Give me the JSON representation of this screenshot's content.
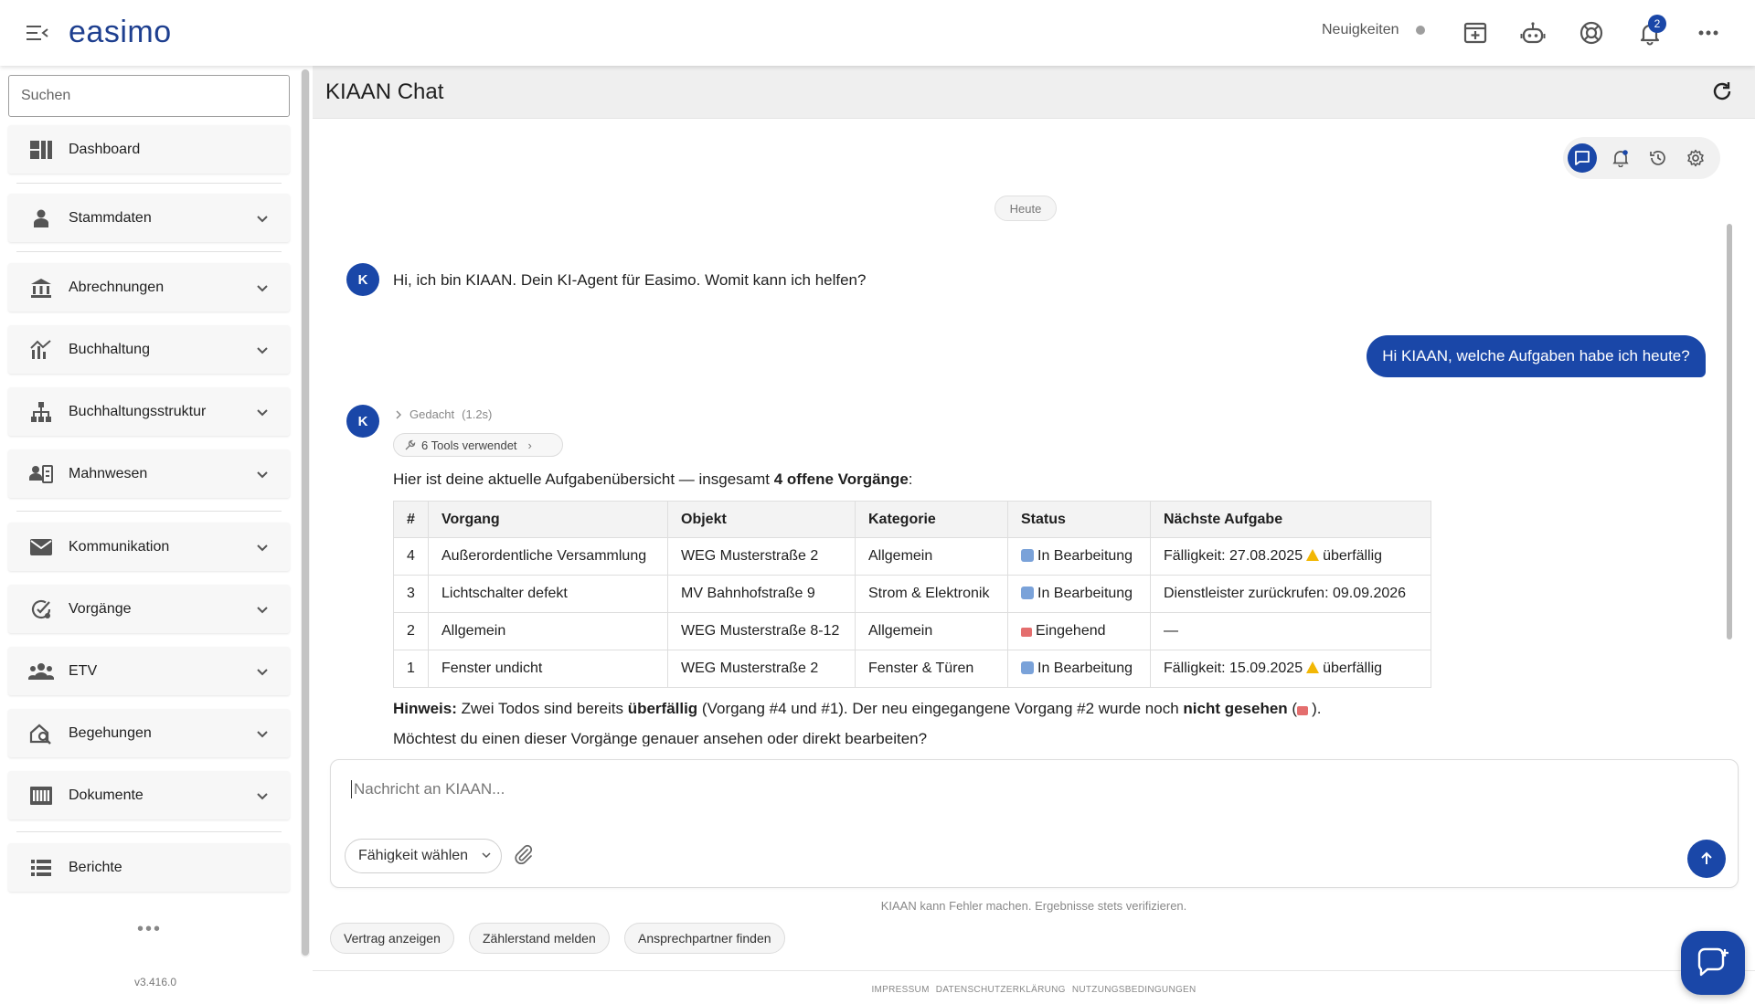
{
  "app": {
    "logo": "easimo",
    "version": "v3.416.0"
  },
  "topbar": {
    "news_label": "Neuigkeiten",
    "notification_count": "2",
    "icons": [
      "add-window-icon",
      "robot-icon",
      "help-lifebuoy-icon",
      "bell-icon",
      "more-horizontal-icon"
    ]
  },
  "sidebar": {
    "search_placeholder": "Suchen",
    "items": [
      {
        "label": "Dashboard",
        "icon": "dashboard-icon",
        "expandable": false
      },
      {
        "label": "Stammdaten",
        "icon": "person-icon",
        "expandable": true
      },
      {
        "label": "Abrechnungen",
        "icon": "bank-icon",
        "expandable": true
      },
      {
        "label": "Buchhaltung",
        "icon": "chart-icon",
        "expandable": true
      },
      {
        "label": "Buchhaltungsstruktur",
        "icon": "hierarchy-icon",
        "expandable": true
      },
      {
        "label": "Mahnwesen",
        "icon": "contact-card-icon",
        "expandable": true
      },
      {
        "label": "Kommunikation",
        "icon": "mail-icon",
        "expandable": true
      },
      {
        "label": "Vorgänge",
        "icon": "task-check-icon",
        "expandable": true
      },
      {
        "label": "ETV",
        "icon": "group-icon",
        "expandable": true
      },
      {
        "label": "Begehungen",
        "icon": "house-search-icon",
        "expandable": true
      },
      {
        "label": "Dokumente",
        "icon": "document-icon",
        "expandable": true
      },
      {
        "label": "Berichte",
        "icon": "list-icon",
        "expandable": false
      }
    ],
    "more": "•••"
  },
  "main": {
    "title": "KIAAN Chat"
  },
  "chat": {
    "date_chip": "Heute",
    "avatar_letter": "K",
    "greeting": "Hi, ich bin KIAAN. Dein KI-Agent für Easimo. Womit kann ich helfen?",
    "user_message": "Hi KIAAN, welche Aufgaben habe ich heute?",
    "thought_label": "Gedacht",
    "thought_time": "(1.2s)",
    "tools_label": "6 Tools verwendet",
    "intro_prefix": "Hier ist deine aktuelle Aufgabenübersicht — insgesamt ",
    "intro_bold": "4 offene Vorgänge",
    "intro_suffix": ":",
    "table": {
      "headers": [
        "#",
        "Vorgang",
        "Objekt",
        "Kategorie",
        "Status",
        "Nächste Aufgabe"
      ],
      "rows": [
        {
          "num": "4",
          "vorgang": "Außerordentliche Versammlung",
          "objekt": "WEG Musterstraße 2",
          "kategorie": "Allgemein",
          "status": "In Bearbeitung",
          "status_type": "in-progress",
          "aufgabe": "Fälligkeit: 27.08.2025",
          "warn": true,
          "warn_text": "überfällig"
        },
        {
          "num": "3",
          "vorgang": "Lichtschalter defekt",
          "objekt": "MV Bahnhofstraße 9",
          "kategorie": "Strom & Elektronik",
          "status": "In Bearbeitung",
          "status_type": "in-progress",
          "aufgabe": "Dienstleister zurückrufen: 09.09.2026",
          "warn": false,
          "warn_text": ""
        },
        {
          "num": "2",
          "vorgang": "Allgemein",
          "objekt": "WEG Musterstraße 8-12",
          "kategorie": "Allgemein",
          "status": "Eingehend",
          "status_type": "incoming",
          "aufgabe": "—",
          "warn": false,
          "warn_text": ""
        },
        {
          "num": "1",
          "vorgang": "Fenster undicht",
          "objekt": "WEG Musterstraße 2",
          "kategorie": "Fenster & Türen",
          "status": "In Bearbeitung",
          "status_type": "in-progress",
          "aufgabe": "Fälligkeit: 15.09.2025",
          "warn": true,
          "warn_text": "überfällig"
        }
      ]
    },
    "note": {
      "label": "Hinweis:",
      "part1": " Zwei Todos sind bereits ",
      "bold1": "überfällig",
      "part2": " (Vorgang #4 und #1). Der neu eingegangene Vorgang #2 wurde noch ",
      "bold2": "nicht gesehen",
      "part3": " (",
      "part4": ")."
    },
    "question": "Möchtest du einen dieser Vorgänge genauer ansehen oder direkt bearbeiten?"
  },
  "composer": {
    "placeholder": "Nachricht an KIAAN...",
    "skill_label": "Fähigkeit wählen"
  },
  "disclaimer": "KIAAN kann Fehler machen. Ergebnisse stets verifizieren.",
  "suggestions": [
    "Vertrag anzeigen",
    "Zählerstand melden",
    "Ansprechpartner finden"
  ],
  "footer": [
    "IMPRESSUM",
    "DATENSCHUTZERKLÄRUNG",
    "NUTZUNGSBEDINGUNGEN"
  ],
  "colors": {
    "brand": "#1a47a8",
    "sidebar_item_bg": "#f7f7f7",
    "header_bg": "#efefef"
  }
}
